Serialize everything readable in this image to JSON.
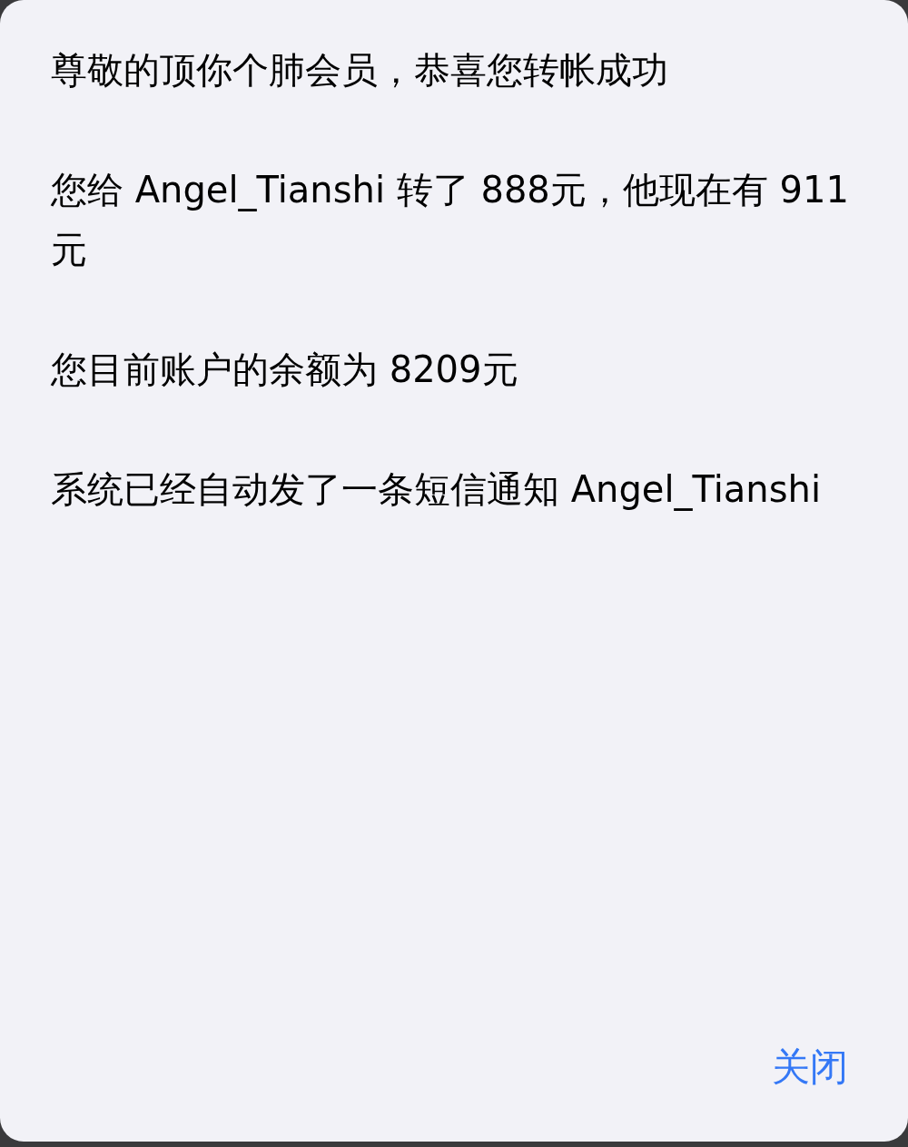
{
  "message": {
    "paragraphs": [
      "尊敬的顶你个肺会员，恭喜您转帐成功",
      "您给 Angel_Tianshi 转了 888元，他现在有 911元",
      "您目前账户的余额为 8209元",
      "系统已经自动发了一条短信通知 Angel_Tianshi"
    ]
  },
  "buttons": [
    {
      "label": "关闭"
    }
  ]
}
